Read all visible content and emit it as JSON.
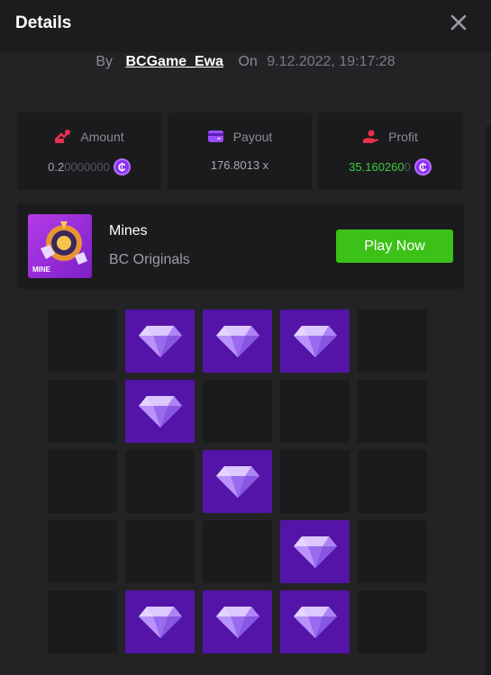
{
  "header": {
    "title": "Details",
    "close_icon": "close-icon"
  },
  "byline": {
    "by_label": "By",
    "username": "BCGame_Ewa",
    "on_label": "On",
    "datetime": "9.12.2022, 19:17:28"
  },
  "stats": {
    "amount": {
      "label": "Amount",
      "value_main": "0.2",
      "value_dim": "0000000",
      "icon": "amount-icon",
      "coin_icon": "bc-coin-icon"
    },
    "payout": {
      "label": "Payout",
      "value": "176.8013 x",
      "icon": "wallet-card-icon"
    },
    "profit": {
      "label": "Profit",
      "value_main": "35.160260",
      "value_dim": "0",
      "icon": "profit-hand-icon",
      "coin_icon": "bc-coin-icon"
    }
  },
  "game": {
    "name": "Mines",
    "provider": "BC Originals",
    "play_label": "Play Now",
    "thumb_label": "MINE"
  },
  "grid": {
    "rows": 5,
    "cols": 5,
    "tiles": [
      "empty",
      "gem",
      "gem",
      "gem",
      "empty",
      "empty",
      "gem",
      "empty",
      "empty",
      "empty",
      "empty",
      "empty",
      "gem",
      "empty",
      "empty",
      "empty",
      "empty",
      "empty",
      "gem",
      "empty",
      "empty",
      "gem",
      "gem",
      "gem",
      "empty"
    ]
  },
  "colors": {
    "accent_green": "#3bc117",
    "gem_tile": "#5414a8",
    "tile": "#1b1b1e",
    "coin": "#8b2ef0"
  },
  "coin_symbol": "₵"
}
